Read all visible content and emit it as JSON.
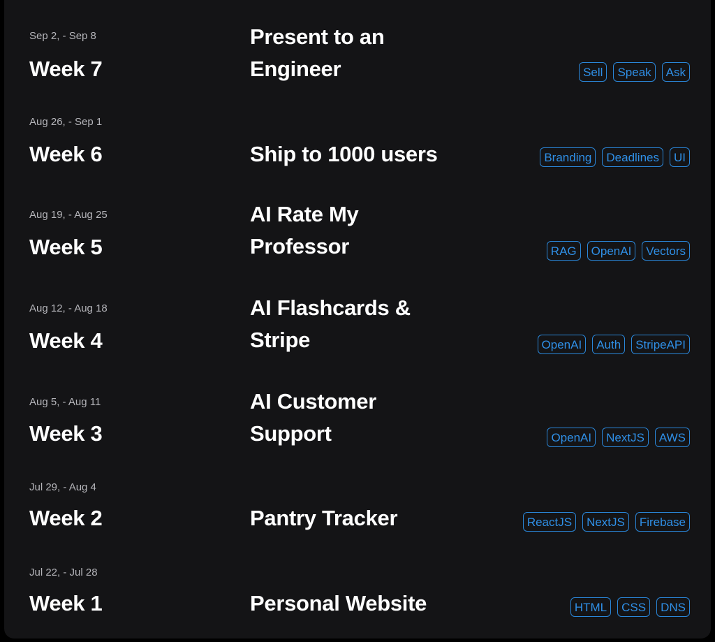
{
  "accent_color": "#2f8fe6",
  "weeks": [
    {
      "dates": "Sep 2, - Sep 8",
      "week": "Week 7",
      "title": "Present to an Engineer",
      "tags": [
        "Sell",
        "Speak",
        "Ask"
      ]
    },
    {
      "dates": "Aug 26, - Sep 1",
      "week": "Week 6",
      "title": "Ship to 1000 users",
      "tags": [
        "Branding",
        "Deadlines",
        "UI"
      ]
    },
    {
      "dates": "Aug 19, - Aug 25",
      "week": "Week 5",
      "title": "AI Rate My Professor",
      "tags": [
        "RAG",
        "OpenAI",
        "Vectors"
      ]
    },
    {
      "dates": "Aug 12, - Aug 18",
      "week": "Week 4",
      "title": "AI Flashcards & Stripe",
      "tags": [
        "OpenAI",
        "Auth",
        "StripeAPI"
      ]
    },
    {
      "dates": "Aug 5, - Aug 11",
      "week": "Week 3",
      "title": "AI Customer Support",
      "tags": [
        "OpenAI",
        "NextJS",
        "AWS"
      ]
    },
    {
      "dates": "Jul 29, - Aug 4",
      "week": "Week 2",
      "title": "Pantry Tracker",
      "tags": [
        "ReactJS",
        "NextJS",
        "Firebase"
      ]
    },
    {
      "dates": "Jul 22, - Jul 28",
      "week": "Week 1",
      "title": "Personal Website",
      "tags": [
        "HTML",
        "CSS",
        "DNS"
      ]
    }
  ]
}
